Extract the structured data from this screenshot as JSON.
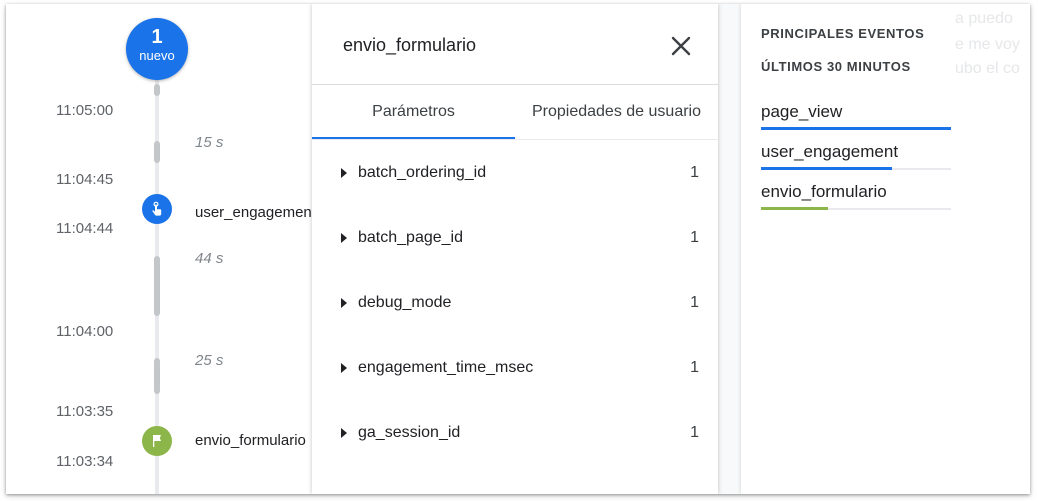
{
  "timeline": {
    "new_count": "1",
    "new_label": "nuevo",
    "timestamps": [
      "11:05:00",
      "11:04:45",
      "11:04:44",
      "11:04:00",
      "11:03:35",
      "11:03:34"
    ],
    "durations": [
      "15 s",
      "44 s",
      "25 s"
    ],
    "events": [
      {
        "name": "user_engagement",
        "icon": "touch-icon",
        "color": "#1a73e8"
      },
      {
        "name": "envio_formulario",
        "icon": "flag-icon",
        "color": "#8cb54a"
      }
    ]
  },
  "details": {
    "title": "envio_formulario",
    "tabs": [
      {
        "label": "Parámetros",
        "active": true
      },
      {
        "label": "Propiedades de usuario",
        "active": false
      }
    ],
    "params": [
      {
        "name": "batch_ordering_id",
        "value": "1"
      },
      {
        "name": "batch_page_id",
        "value": "1"
      },
      {
        "name": "debug_mode",
        "value": "1"
      },
      {
        "name": "engagement_time_msec",
        "value": "1"
      },
      {
        "name": "ga_session_id",
        "value": "1"
      }
    ]
  },
  "top_events": {
    "heading": "PRINCIPALES EVENTOS",
    "subheading": "ÚLTIMOS 30 MINUTOS",
    "items": [
      {
        "name": "page_view",
        "share": 1.0,
        "color": "#1a73e8"
      },
      {
        "name": "user_engagement",
        "share": 0.69,
        "color": "#1a73e8"
      },
      {
        "name": "envio_formulario",
        "share": 0.35,
        "color": "#8cb54a"
      }
    ],
    "background_text": [
      "a puedo",
      "e me voy",
      "ubo el co"
    ]
  },
  "colors": {
    "accent": "#1a73e8",
    "success": "#8cb54a"
  }
}
